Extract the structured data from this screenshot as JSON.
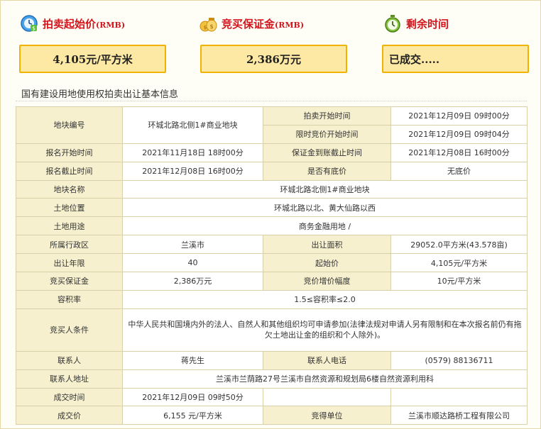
{
  "header": {
    "start_price": {
      "label": "拍卖起始价",
      "sub": "(RMB)",
      "value": "4,105元/平方米",
      "icon": "clock-badge-icon"
    },
    "deposit": {
      "label": "竞买保证金",
      "sub": "(RMB)",
      "value": "2,386万元",
      "icon": "money-bags-icon"
    },
    "remaining": {
      "label": "剩余时间",
      "value": "已成交.....",
      "icon": "stopwatch-icon"
    }
  },
  "section_title": "国有建设用地使用权拍卖出让基本信息",
  "table": {
    "plot_no_label": "地块编号",
    "plot_no": "环城北路北侧1#商业地块",
    "auction_start_label": "拍卖开始时间",
    "auction_start": "2021年12月09日 09时00分",
    "timed_bid_start_label": "限时竞价开始时间",
    "timed_bid_start": "2021年12月09日 09时04分",
    "reg_start_label": "报名开始时间",
    "reg_start": "2021年11月18日 18时00分",
    "deposit_deadline_label": "保证金到账截止时间",
    "deposit_deadline": "2021年12月08日 16时00分",
    "reg_end_label": "报名截止时间",
    "reg_end": "2021年12月08日 16时00分",
    "reserve_label": "是否有底价",
    "reserve": "无底价",
    "plot_name_label": "地块名称",
    "plot_name": "环城北路北侧1#商业地块",
    "location_label": "土地位置",
    "location": "环城北路以北、黄大仙路以西",
    "usage_label": "土地用途",
    "usage": "商务金融用地 /",
    "district_label": "所属行政区",
    "district": "兰溪市",
    "area_label": "出让面积",
    "area": "29052.0平方米(43.578亩)",
    "term_label": "出让年限",
    "term": "40",
    "start_price_label": "起始价",
    "start_price": "4,105元/平方米",
    "deposit_label": "竞买保证金",
    "deposit": "2,386万元",
    "increment_label": "竞价增价幅度",
    "increment": "10元/平方米",
    "far_label": "容积率",
    "far": "1.5≤容积率≤2.0",
    "conditions_label": "竞买人条件",
    "conditions": "中华人民共和国境内外的法人、自然人和其他组织均可申请参加(法律法规对申请人另有限制和在本次报名前仍有拖欠土地出让金的组织和个人除外)。",
    "contact_label": "联系人",
    "contact": "蒋先生",
    "phone_label": "联系人电话",
    "phone": "(0579) 88136711",
    "address_label": "联系人地址",
    "address": "兰溪市兰荫路27号兰溪市自然资源和规划局6楼自然资源利用科",
    "deal_time_label": "成交时间",
    "deal_time": "2021年12月09日 09时50分",
    "deal_price_label": "成交价",
    "deal_price": "6,155 元/平方米",
    "winner_label": "竞得单位",
    "winner": "兰溪市顺达路桥工程有限公司"
  },
  "colors": {
    "accent_red": "#d4141c",
    "value_box_fill": "#fde9a3",
    "value_box_border": "#f0b400",
    "key_cell_bg": "#f6f0cf"
  }
}
